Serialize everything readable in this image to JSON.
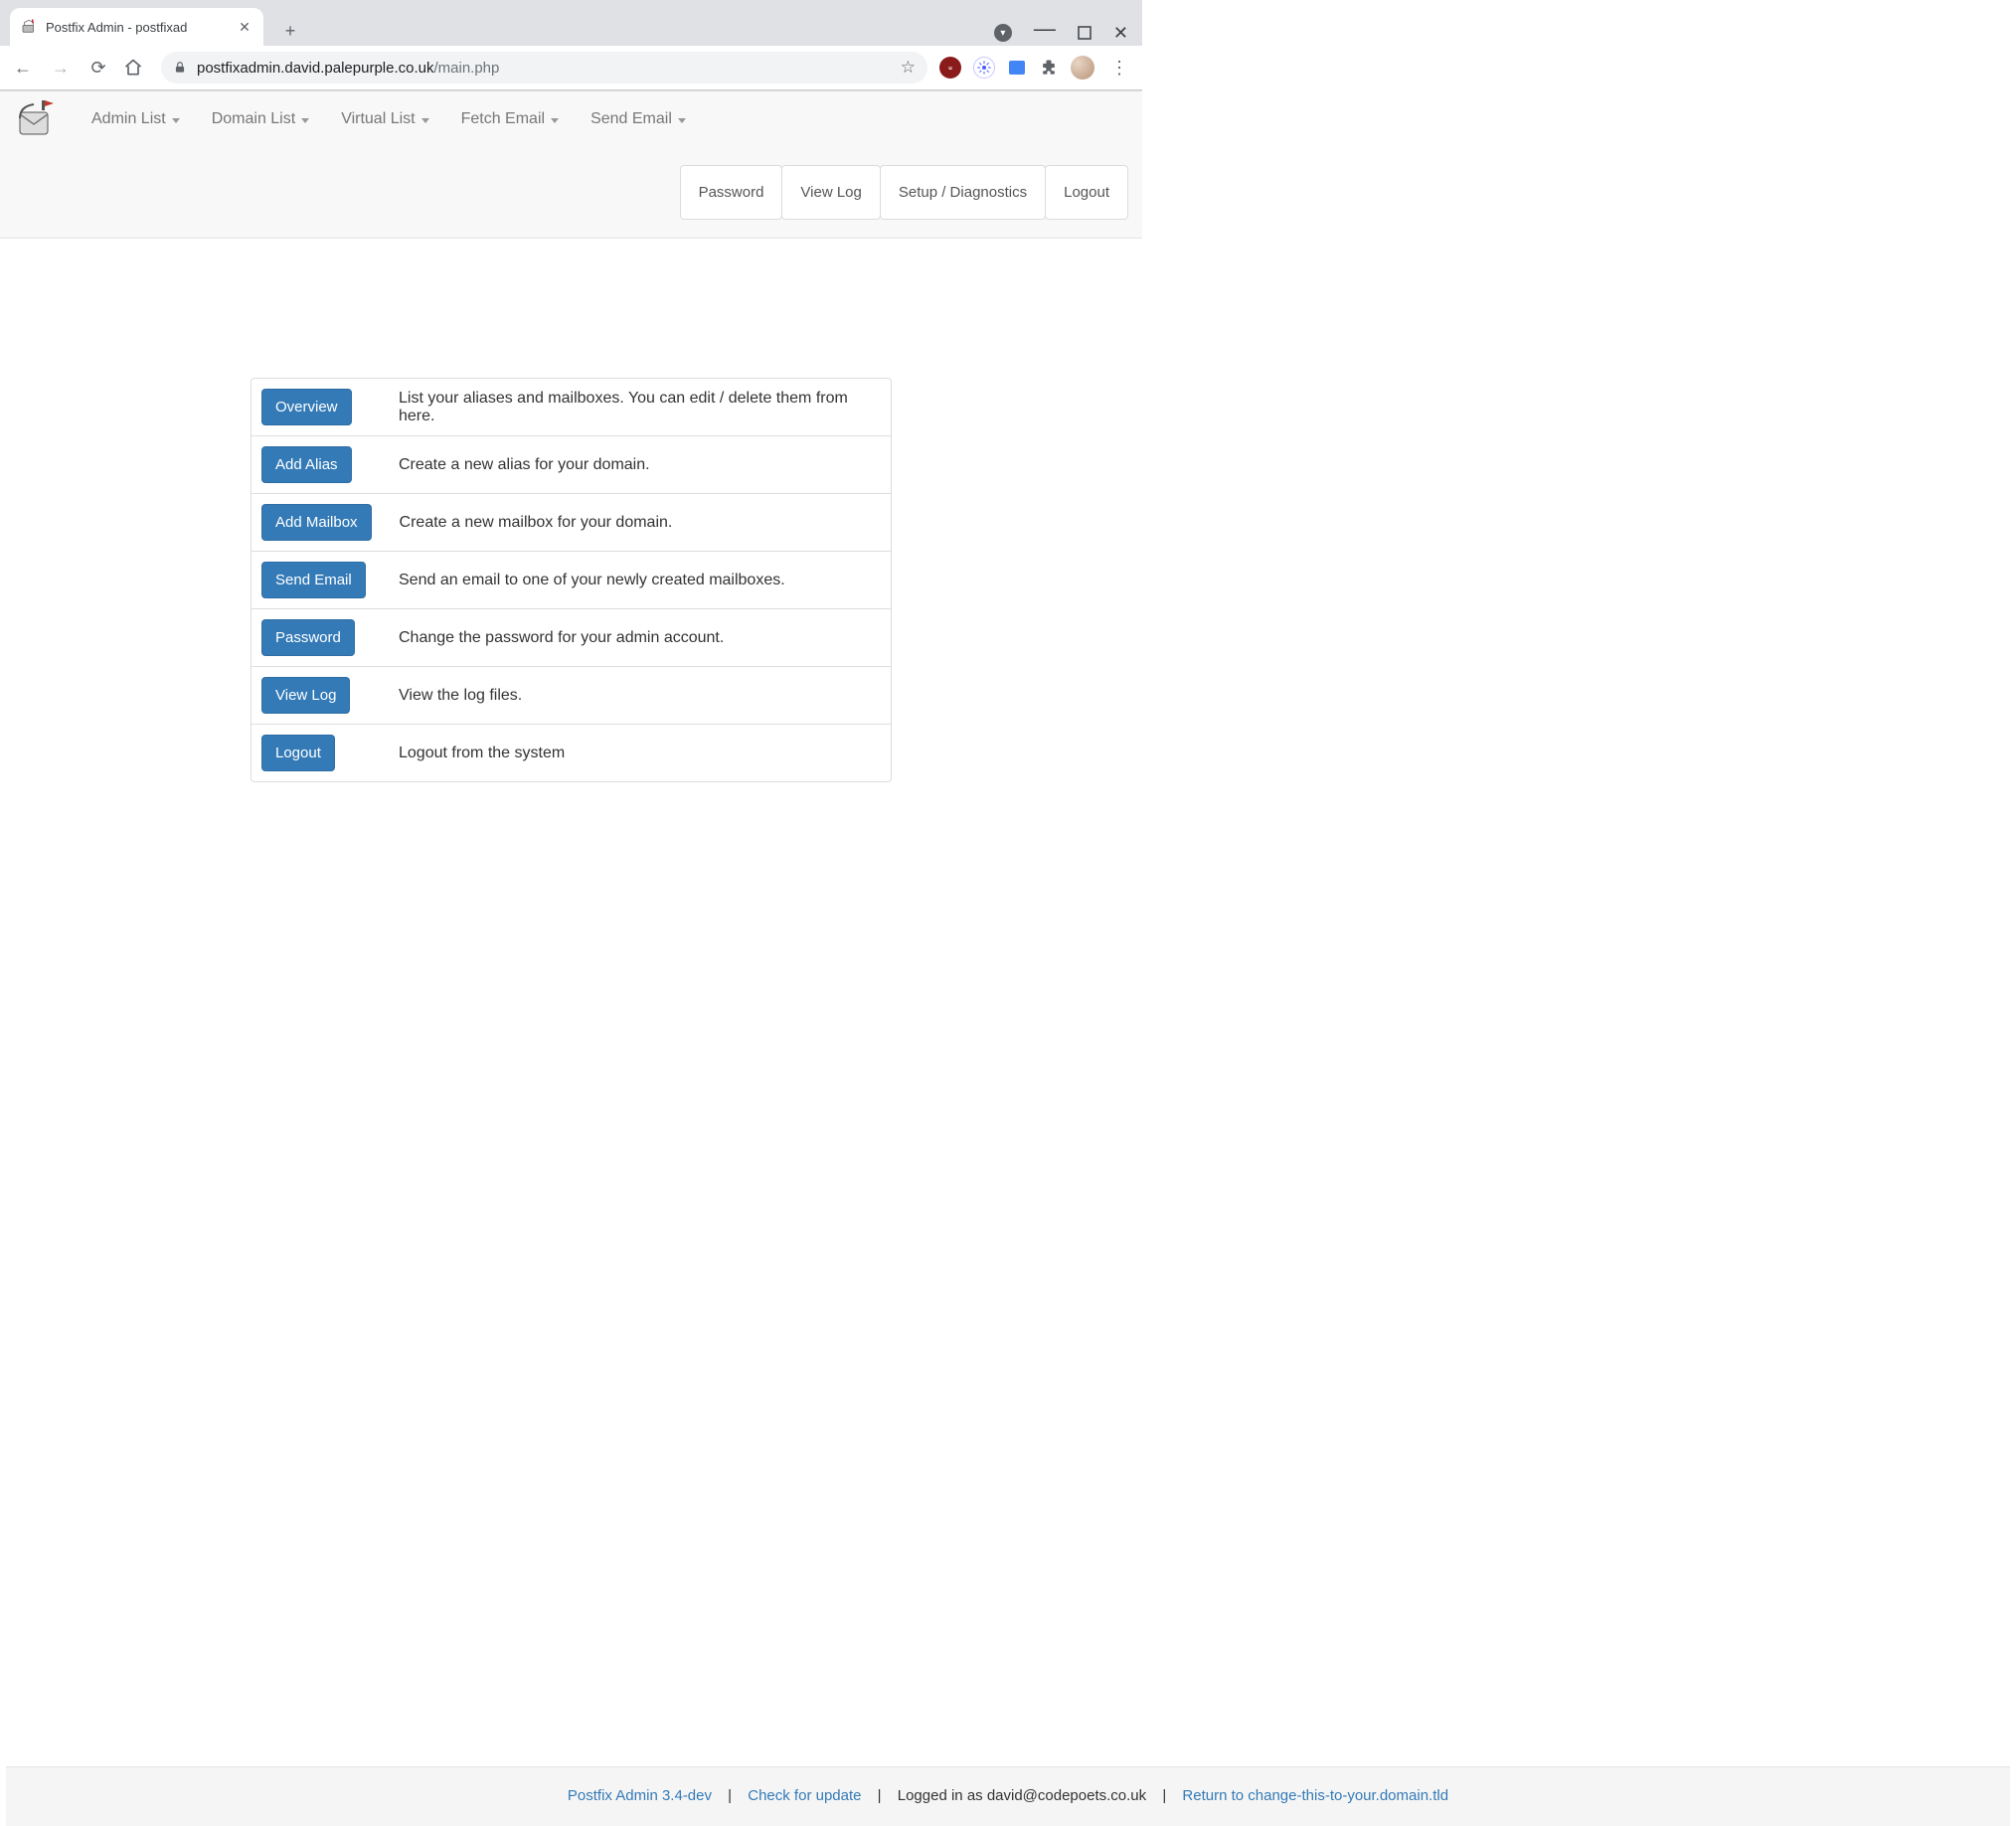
{
  "browser": {
    "tab_title": "Postfix Admin - postfixad",
    "url_host": "postfixadmin.david.palepurple.co.uk",
    "url_path": "/main.php"
  },
  "nav": {
    "items": [
      "Admin List",
      "Domain List",
      "Virtual List",
      "Fetch Email",
      "Send Email"
    ],
    "right": [
      "Password",
      "View Log",
      "Setup / Diagnostics",
      "Logout"
    ]
  },
  "main_rows": [
    {
      "btn": "Overview",
      "desc": "List your aliases and mailboxes. You can edit / delete them from here."
    },
    {
      "btn": "Add Alias",
      "desc": "Create a new alias for your domain."
    },
    {
      "btn": "Add Mailbox",
      "desc": "Create a new mailbox for your domain."
    },
    {
      "btn": "Send Email",
      "desc": "Send an email to one of your newly created mailboxes."
    },
    {
      "btn": "Password",
      "desc": "Change the password for your admin account."
    },
    {
      "btn": "View Log",
      "desc": "View the log files."
    },
    {
      "btn": "Logout",
      "desc": "Logout from the system"
    }
  ],
  "footer": {
    "version_link": "Postfix Admin 3.4-dev",
    "check_update": "Check for update",
    "logged_in": "Logged in as david@codepoets.co.uk",
    "return_link": "Return to change-this-to-your.domain.tld"
  }
}
